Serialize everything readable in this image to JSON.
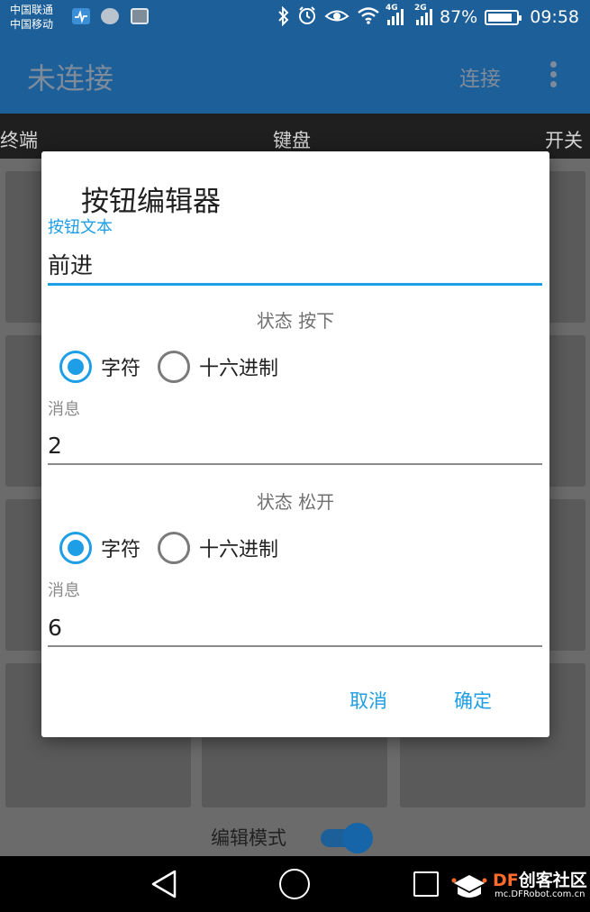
{
  "status_bar": {
    "carrier_1": "中国联通",
    "carrier_2": "中国移动",
    "battery_percent": "87%",
    "battery_level": 0.87,
    "time": "09:58",
    "network_1": "4G",
    "network_2": "2G"
  },
  "app_bar": {
    "title": "未连接",
    "connect_label": "连接"
  },
  "tabs": {
    "terminal": "终端",
    "keyboard": "键盘",
    "switch": "开关",
    "active": "keyboard"
  },
  "edit_mode": {
    "label": "编辑模式",
    "enabled": true
  },
  "dialog": {
    "title": "按钮编辑器",
    "button_text": {
      "label": "按钮文本",
      "value": "前进"
    },
    "pressed": {
      "heading": "状态 按下",
      "radio_char": "字符",
      "radio_hex": "十六进制",
      "selected": "字符",
      "message_label": "消息",
      "message_value": "2"
    },
    "released": {
      "heading": "状态 松开",
      "radio_char": "字符",
      "radio_hex": "十六进制",
      "selected": "字符",
      "message_label": "消息",
      "message_value": "6"
    },
    "cancel_label": "取消",
    "ok_label": "确定"
  },
  "watermark": {
    "brand_prefix": "DF",
    "brand_suffix": "创客社区",
    "url": "mc.DFRobot.com.cn"
  },
  "colors": {
    "accent": "#1e9ee6",
    "app_bar": "#1d5f99",
    "brand_orange": "#ff6b2b"
  }
}
